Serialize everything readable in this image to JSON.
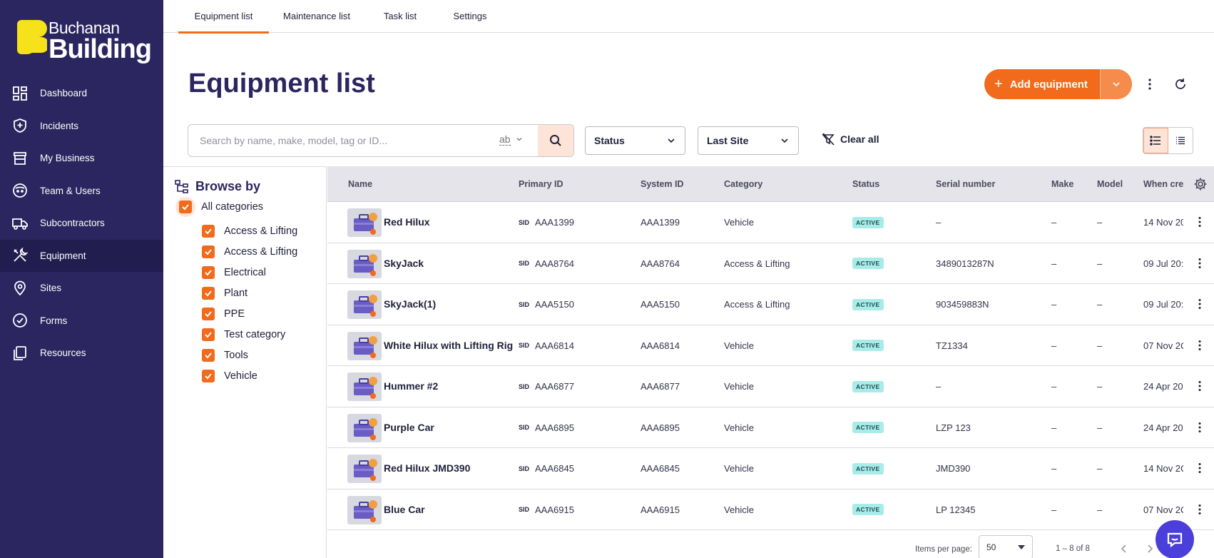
{
  "brand": {
    "line1": "Buchanan",
    "line2": "Building",
    "accent": "#f26a1b",
    "sidebar_bg": "#2b2560",
    "logo_yellow": "#f5e21a"
  },
  "sidebar": {
    "items": [
      {
        "label": "Dashboard",
        "icon": "dashboard-icon"
      },
      {
        "label": "Incidents",
        "icon": "shield-icon"
      },
      {
        "label": "My Business",
        "icon": "store-icon"
      },
      {
        "label": "Team & Users",
        "icon": "team-icon"
      },
      {
        "label": "Subcontractors",
        "icon": "truck-icon"
      },
      {
        "label": "Equipment",
        "icon": "tools-icon",
        "active": true
      },
      {
        "label": "Sites",
        "icon": "location-pin-icon"
      },
      {
        "label": "Forms",
        "icon": "check-circle-icon"
      },
      {
        "label": "Resources",
        "icon": "copy-icon"
      }
    ]
  },
  "tabs": {
    "items": [
      {
        "label": "Equipment list",
        "active": true
      },
      {
        "label": "Maintenance list"
      },
      {
        "label": "Task list"
      },
      {
        "label": "Settings"
      }
    ]
  },
  "header": {
    "title": "Equipment list",
    "add_label": "Add equipment"
  },
  "filters": {
    "search_placeholder": "Search by name, make, model, tag or ID...",
    "search_mode": "ab",
    "status_label": "Status",
    "site_label": "Last Site",
    "clear_label": "Clear all"
  },
  "browse": {
    "title": "Browse by",
    "all_label": "All categories",
    "categories": [
      "Access & Lifting",
      "Access & Lifting",
      "Electrical",
      "Plant",
      "PPE",
      "Test category",
      "Tools",
      "Vehicle"
    ]
  },
  "table": {
    "columns": [
      "Name",
      "Primary ID",
      "System ID",
      "Category",
      "Status",
      "Serial number",
      "Make",
      "Model",
      "When cre"
    ],
    "sid_tag": "SID",
    "rows": [
      {
        "name": "Red Hilux",
        "primary_id": "AAA1399",
        "system_id": "AAA1399",
        "category": "Vehicle",
        "status": "ACTIVE",
        "serial": "–",
        "make": "–",
        "model": "–",
        "created": "14 Nov 20"
      },
      {
        "name": "SkyJack",
        "primary_id": "AAA8764",
        "system_id": "AAA8764",
        "category": "Access & Lifting",
        "status": "ACTIVE",
        "serial": "3489013287N",
        "make": "–",
        "model": "–",
        "created": "09 Jul 20:"
      },
      {
        "name": "SkyJack(1)",
        "primary_id": "AAA5150",
        "system_id": "AAA5150",
        "category": "Access & Lifting",
        "status": "ACTIVE",
        "serial": "903459883N",
        "make": "–",
        "model": "–",
        "created": "09 Jul 20:"
      },
      {
        "name": "White Hilux with Lifting Rig",
        "primary_id": "AAA6814",
        "system_id": "AAA6814",
        "category": "Vehicle",
        "status": "ACTIVE",
        "serial": "TZ1334",
        "make": "–",
        "model": "–",
        "created": "07 Nov 2C"
      },
      {
        "name": "Hummer #2",
        "primary_id": "AAA6877",
        "system_id": "AAA6877",
        "category": "Vehicle",
        "status": "ACTIVE",
        "serial": "–",
        "make": "–",
        "model": "–",
        "created": "24 Apr 20"
      },
      {
        "name": "Purple Car",
        "primary_id": "AAA6895",
        "system_id": "AAA6895",
        "category": "Vehicle",
        "status": "ACTIVE",
        "serial": "LZP 123",
        "make": "–",
        "model": "–",
        "created": "24 Apr 20"
      },
      {
        "name": "Red Hilux JMD390",
        "primary_id": "AAA6845",
        "system_id": "AAA6845",
        "category": "Vehicle",
        "status": "ACTIVE",
        "serial": "JMD390",
        "make": "–",
        "model": "–",
        "created": "14 Nov 2C"
      },
      {
        "name": "Blue Car",
        "primary_id": "AAA6915",
        "system_id": "AAA6915",
        "category": "Vehicle",
        "status": "ACTIVE",
        "serial": "LP 12345",
        "make": "–",
        "model": "–",
        "created": "07 Nov 2C"
      }
    ]
  },
  "pagination": {
    "items_label": "Items per page:",
    "per_page": "50",
    "range": "1 – 8 of 8"
  }
}
